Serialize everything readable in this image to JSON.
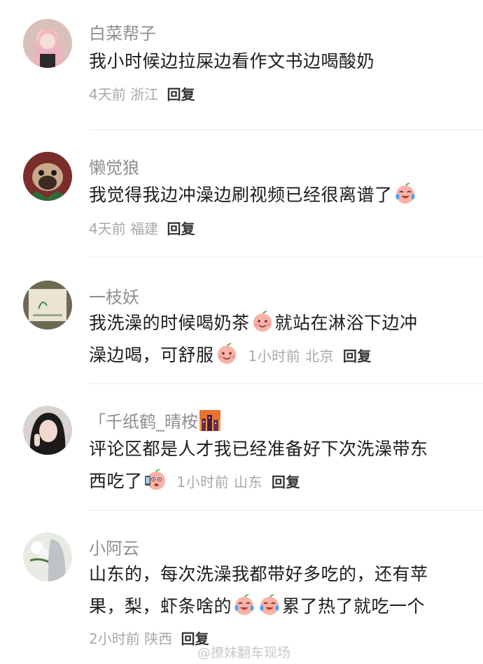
{
  "comments": [
    {
      "username": "白菜帮子",
      "text": "我小时候边拉屎边看作文书边喝酸奶",
      "time": "4天前",
      "location": "浙江",
      "reply_label": "回复"
    },
    {
      "username": "懒觉狼",
      "text": "我觉得我边冲澡边刷视频已经很离谱了",
      "time": "4天前",
      "location": "福建",
      "reply_label": "回复",
      "emoji": "crying-laughing-peach-emoji"
    },
    {
      "username": "一枝妖",
      "text_part1": "我洗澡的时候喝奶茶",
      "text_part2": "就站在淋浴下边冲",
      "text_part3": "澡边喝，可舒服",
      "time": "1小时前",
      "location": "北京",
      "reply_label": "回复",
      "emoji": "smiling-peach-emoji"
    },
    {
      "username": "「千纸鹤_晴桉",
      "username_badge": "city-skyline-icon",
      "text": "评论区都是人才我已经准备好下次洗澡带东西吃了",
      "text_line1": "评论区都是人才我已经准备好下次洗澡带东",
      "text_line2": "西吃了",
      "time": "1小时前",
      "location": "山东",
      "reply_label": "回复",
      "emoji": "peach-with-phone-emoji"
    },
    {
      "username": "小阿云",
      "text_line1": "山东的，每次洗澡我都带好多吃的，还有苹",
      "text_line2a": "果，梨，虾条啥的",
      "text_line2b": "累了热了就吃一个",
      "time": "2小时前",
      "location": "陕西",
      "reply_label": "回复",
      "emoji": "crying-laughing-peach-emoji"
    }
  ],
  "watermark": "@撩妹翻车现场",
  "colors": {
    "username": "#8e8e8e",
    "text": "#1c1c1c",
    "meta": "#a8a8a8",
    "reply": "#333333",
    "divider": "#ececec"
  }
}
